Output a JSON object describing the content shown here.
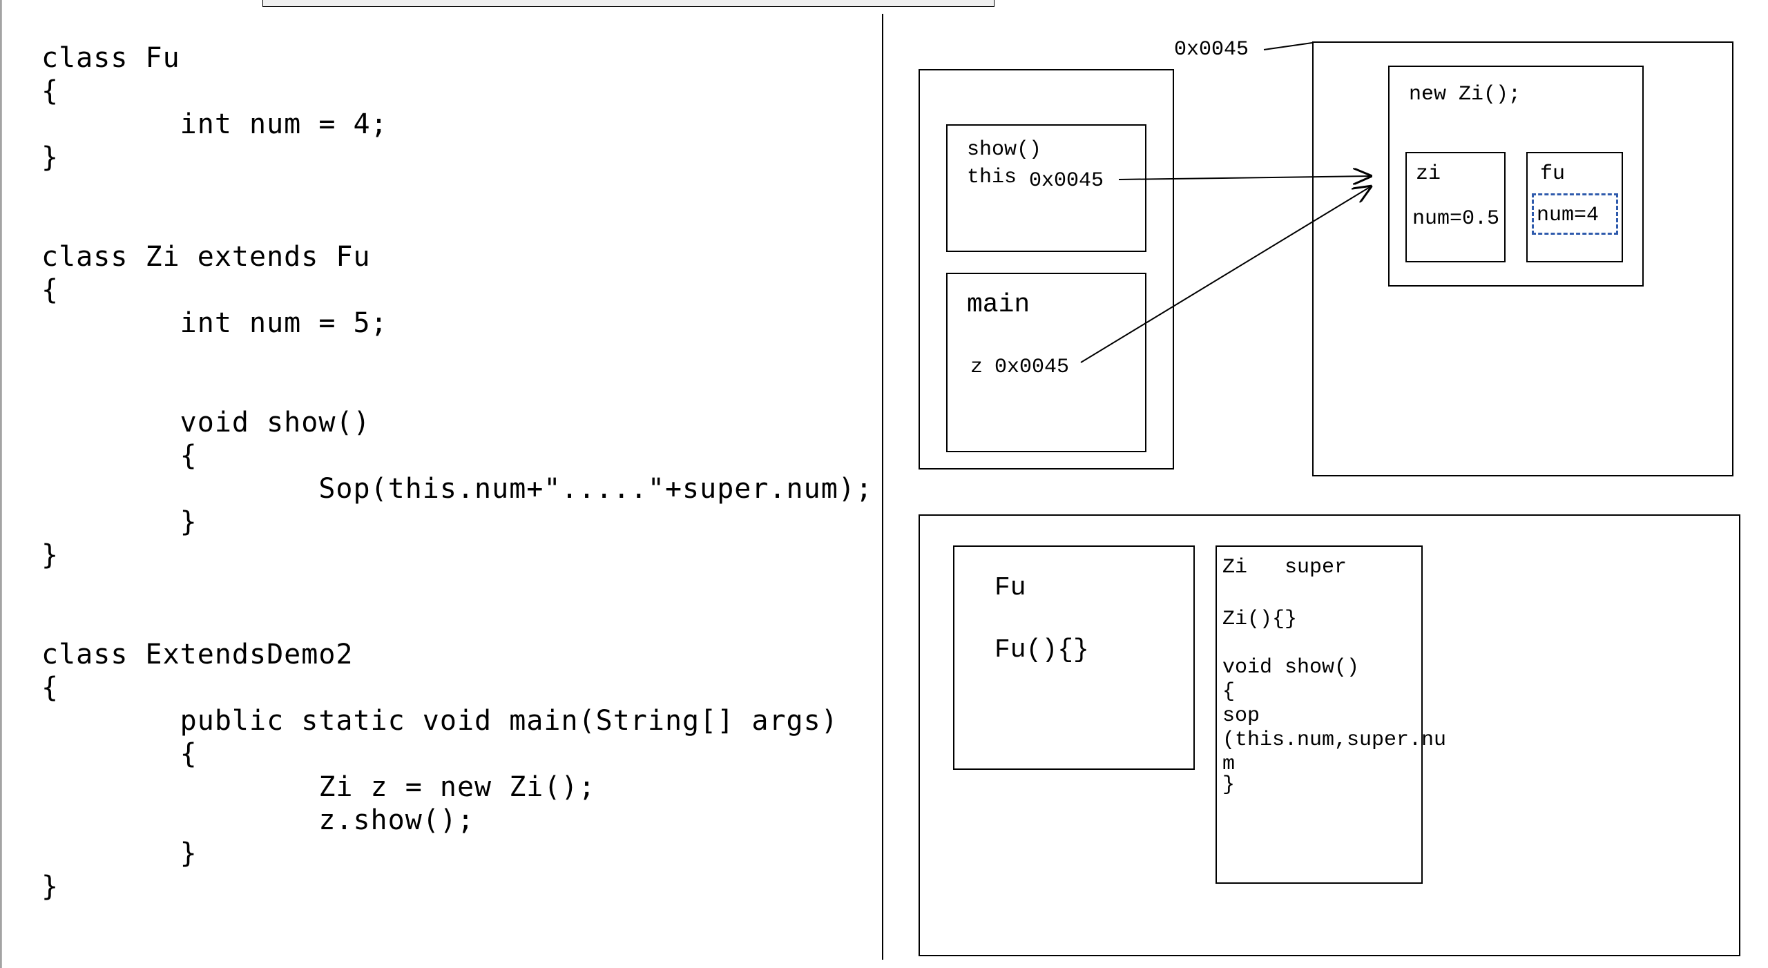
{
  "code": {
    "text": "class Fu\n{\n        int num = 4;\n}\n\n\nclass Zi extends Fu\n{\n        int num = 5;\n\n\n        void show()\n        {\n                Sop(this.num+\".....\"+super.num);\n        }\n}\n\n\nclass ExtendsDemo2\n{\n        public static void main(String[] args)\n        {\n                Zi z = new Zi();\n                z.show();\n        }\n}"
  },
  "heap_addr": "0x0045",
  "stack": {
    "show_frame": {
      "label": "show()",
      "this_label": "this",
      "this_value": "0x0045"
    },
    "main_frame": {
      "label": "main",
      "z_label": "z",
      "z_value": "0x0045"
    }
  },
  "heap_obj": {
    "title": "new Zi();",
    "zi_box": {
      "label": "zi",
      "field": "num=0.5"
    },
    "fu_box": {
      "label": "fu",
      "field": "num=4"
    }
  },
  "method_area": {
    "fu_box": {
      "title": "Fu",
      "ctor": "Fu(){}"
    },
    "zi_box": {
      "line1": "Zi   super",
      "line2": "Zi(){}",
      "line3": "void show()",
      "line4": "{",
      "line5": "sop",
      "line6": "(this.num,super.nu",
      "line7": "m",
      "line8": "}"
    }
  }
}
